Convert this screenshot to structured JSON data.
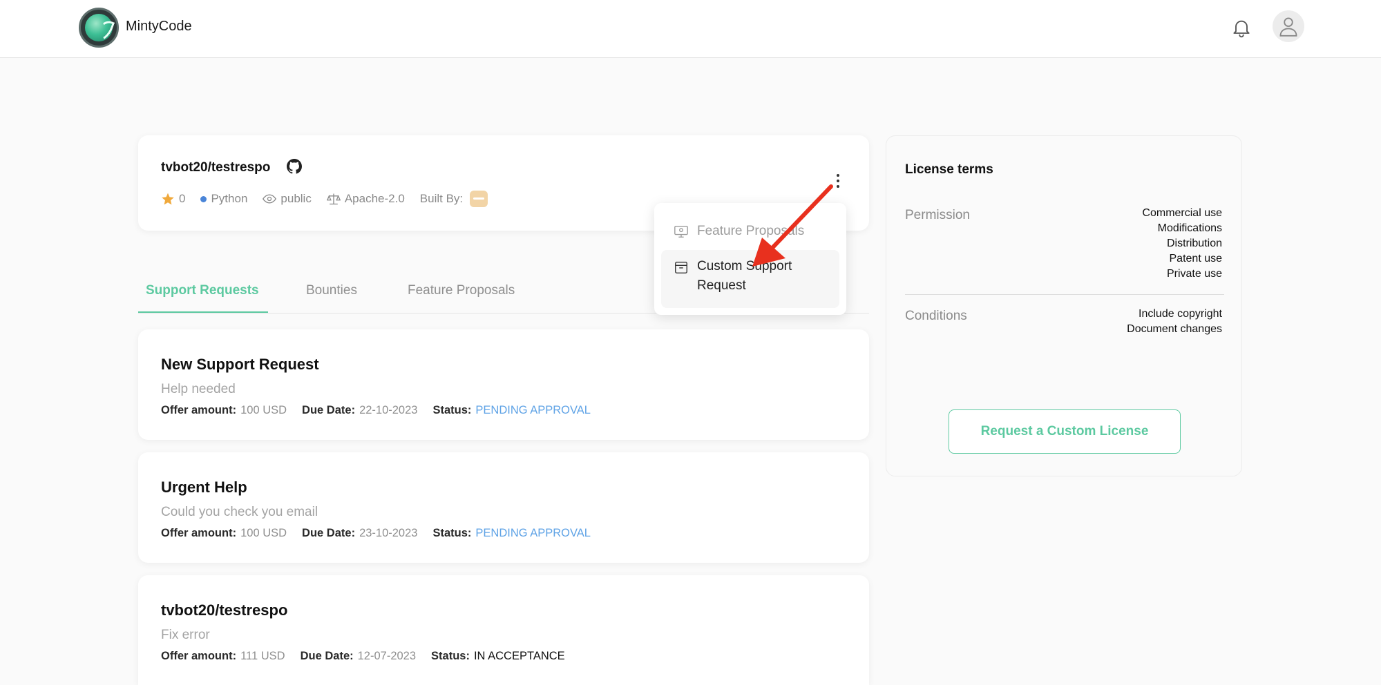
{
  "header": {
    "brand": "MintyCode"
  },
  "repo": {
    "name": "tvbot20/testrespo",
    "stars": "0",
    "language": "Python",
    "visibility": "public",
    "license": "Apache-2.0",
    "built_by_label": "Built By:"
  },
  "dropdown": {
    "items": [
      {
        "label": "Feature Proposals",
        "icon": "presentation-icon",
        "disabled": true
      },
      {
        "label": "Custom Support Request",
        "icon": "calendar-icon",
        "disabled": false
      }
    ]
  },
  "tabs": [
    {
      "label": "Support Requests",
      "active": true
    },
    {
      "label": "Bounties",
      "active": false
    },
    {
      "label": "Feature Proposals",
      "active": false
    }
  ],
  "labels": {
    "offer_amount": "Offer amount:",
    "due_date": "Due Date:",
    "status": "Status:"
  },
  "requests": [
    {
      "title": "New Support Request",
      "description": "Help needed",
      "offer_amount": "100 USD",
      "due_date": "22-10-2023",
      "status": "PENDING APPROVAL"
    },
    {
      "title": "Urgent Help",
      "description": "Could you check you email",
      "offer_amount": "100 USD",
      "due_date": "23-10-2023",
      "status": "PENDING APPROVAL"
    },
    {
      "title": "tvbot20/testrespo",
      "description": "Fix error",
      "offer_amount": "111 USD",
      "due_date": "12-07-2023",
      "status": "IN ACCEPTANCE"
    }
  ],
  "license_terms": {
    "title": "License terms",
    "permission_label": "Permission",
    "permissions": [
      "Commercial use",
      "Modifications",
      "Distribution",
      "Patent use",
      "Private use"
    ],
    "conditions_label": "Conditions",
    "conditions": [
      "Include copyright",
      "Document changes"
    ],
    "button_label": "Request a Custom License"
  },
  "colors": {
    "accent": "#5cc9a0",
    "pending": "#5fa3e6",
    "arrow": "#e8301e"
  }
}
